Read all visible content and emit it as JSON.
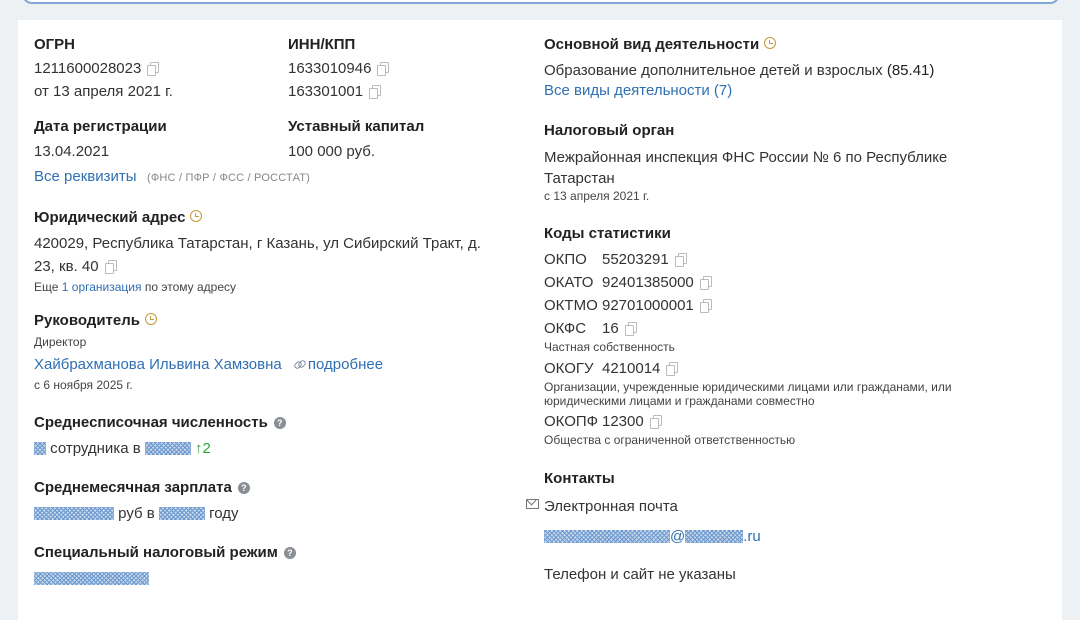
{
  "ogrn": {
    "label": "ОГРН",
    "value": "1211600028023",
    "date": "от 13 апреля 2021 г."
  },
  "inn_kpp": {
    "label": "ИНН/КПП",
    "inn": "1633010946",
    "kpp": "163301001"
  },
  "reg_date": {
    "label": "Дата регистрации",
    "value": "13.04.2021"
  },
  "capital": {
    "label": "Уставный капитал",
    "value": "100 000 руб."
  },
  "all_details": {
    "link": "Все реквизиты",
    "note": "(ФНС / ПФР / ФСС / РОССТАТ)"
  },
  "address": {
    "label": "Юридический адрес",
    "line1": "420029, Республика Татарстан, г Казань, ул Сибирский Тракт, д.",
    "line2": "23, кв. 40",
    "more_prefix": "Еще",
    "more_link": "1 организация",
    "more_suffix": "по этому адресу"
  },
  "head": {
    "label": "Руководитель",
    "role": "Директор",
    "name": "Хайбрахманова Ильвина Хамзовна",
    "more": "подробнее",
    "since": "с 6 ноября 2025 г."
  },
  "headcount": {
    "label": "Среднесписочная численность",
    "text1": "сотрудника в",
    "delta": "↑2"
  },
  "salary": {
    "label": "Среднемесячная зарплата",
    "text1": "руб в",
    "text2": "году"
  },
  "tax_regime": {
    "label": "Специальный налоговый режим"
  },
  "activity": {
    "label": "Основной вид деятельности",
    "value": "Образование дополнительное детей и взрослых",
    "code": "(85.41)",
    "all_link": "Все виды деятельности (7)"
  },
  "tax_office": {
    "label": "Налоговый орган",
    "line1": "Межрайонная инспекция ФНС России № 6 по Республике",
    "line2": "Татарстан",
    "since": "с 13 апреля 2021 г."
  },
  "stats": {
    "label": "Коды статистики",
    "okpo": {
      "k": "ОКПО",
      "v": "55203291"
    },
    "okato": {
      "k": "ОКАТО",
      "v": "92401385000"
    },
    "oktmo": {
      "k": "ОКТМО",
      "v": "92701000001"
    },
    "okfs": {
      "k": "ОКФС",
      "v": "16",
      "desc": "Частная собственность"
    },
    "okogu": {
      "k": "ОКОГУ",
      "v": "4210014",
      "desc1": "Организации, учрежденные юридическими лицами или гражданами, или",
      "desc2": "юридическими лицами и гражданами совместно"
    },
    "okopf": {
      "k": "ОКОПФ",
      "v": "12300",
      "desc": "Общества с ограниченной ответственностью"
    }
  },
  "contacts": {
    "label": "Контакты",
    "email_label": "Электронная почта",
    "email_at": "@",
    "email_tld": ".ru",
    "phone_note": "Телефон и сайт не указаны"
  },
  "colors": {
    "link": "#2f6fb3",
    "up": "#2aa43b",
    "clock": "#c49a3a",
    "mask": "#6d98cc"
  }
}
